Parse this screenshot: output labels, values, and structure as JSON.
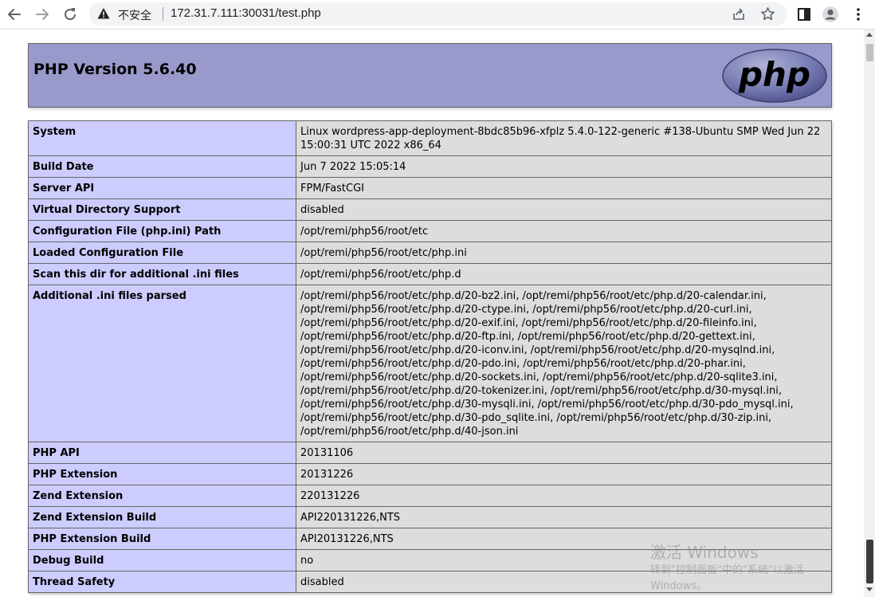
{
  "browser": {
    "security_label": "不安全",
    "url": "172.31.7.111:30031/test.php"
  },
  "page": {
    "title": "PHP Version 5.6.40",
    "logo_text": "php",
    "rows": [
      {
        "key": "System",
        "value": [
          "Linux wordpress-app-deployment-8bdc85b96-xfplz 5.4.0-122-generic #138-Ubuntu SMP Wed Jun 22",
          "15:00:31 UTC 2022 x86_64"
        ]
      },
      {
        "key": "Build Date",
        "value": [
          "Jun 7 2022 15:05:14"
        ]
      },
      {
        "key": "Server API",
        "value": [
          "FPM/FastCGI"
        ]
      },
      {
        "key": "Virtual Directory Support",
        "value": [
          "disabled"
        ]
      },
      {
        "key": "Configuration File (php.ini) Path",
        "value": [
          "/opt/remi/php56/root/etc"
        ]
      },
      {
        "key": "Loaded Configuration File",
        "value": [
          "/opt/remi/php56/root/etc/php.ini"
        ]
      },
      {
        "key": "Scan this dir for additional .ini files",
        "value": [
          "/opt/remi/php56/root/etc/php.d"
        ]
      },
      {
        "key": "Additional .ini files parsed",
        "value": [
          "/opt/remi/php56/root/etc/php.d/20-bz2.ini, /opt/remi/php56/root/etc/php.d/20-calendar.ini,",
          "/opt/remi/php56/root/etc/php.d/20-ctype.ini, /opt/remi/php56/root/etc/php.d/20-curl.ini,",
          "/opt/remi/php56/root/etc/php.d/20-exif.ini, /opt/remi/php56/root/etc/php.d/20-fileinfo.ini,",
          "/opt/remi/php56/root/etc/php.d/20-ftp.ini, /opt/remi/php56/root/etc/php.d/20-gettext.ini,",
          "/opt/remi/php56/root/etc/php.d/20-iconv.ini, /opt/remi/php56/root/etc/php.d/20-mysqlnd.ini,",
          "/opt/remi/php56/root/etc/php.d/20-pdo.ini, /opt/remi/php56/root/etc/php.d/20-phar.ini,",
          "/opt/remi/php56/root/etc/php.d/20-sockets.ini, /opt/remi/php56/root/etc/php.d/20-sqlite3.ini,",
          "/opt/remi/php56/root/etc/php.d/20-tokenizer.ini, /opt/remi/php56/root/etc/php.d/30-mysql.ini,",
          "/opt/remi/php56/root/etc/php.d/30-mysqli.ini, /opt/remi/php56/root/etc/php.d/30-pdo_mysql.ini,",
          "/opt/remi/php56/root/etc/php.d/30-pdo_sqlite.ini, /opt/remi/php56/root/etc/php.d/30-zip.ini,",
          "/opt/remi/php56/root/etc/php.d/40-json.ini"
        ]
      },
      {
        "key": "PHP API",
        "value": [
          "20131106"
        ]
      },
      {
        "key": "PHP Extension",
        "value": [
          "20131226"
        ]
      },
      {
        "key": "Zend Extension",
        "value": [
          "220131226"
        ]
      },
      {
        "key": "Zend Extension Build",
        "value": [
          "API220131226,NTS"
        ]
      },
      {
        "key": "PHP Extension Build",
        "value": [
          "API20131226,NTS"
        ]
      },
      {
        "key": "Debug Build",
        "value": [
          "no"
        ]
      },
      {
        "key": "Thread Safety",
        "value": [
          "disabled"
        ]
      }
    ]
  },
  "watermark": {
    "title": "激活 Windows",
    "subtitle_1": "转到\"控制面板\"中的\"系统\"以激活",
    "subtitle_2": "Windows。"
  },
  "colors": {
    "header_bg": "#9999cc",
    "key_cell_bg": "#ccccff",
    "value_cell_bg": "#dddddd",
    "border": "#666666"
  },
  "icons": [
    "back-arrow-icon",
    "forward-arrow-icon",
    "reload-icon",
    "warning-icon",
    "share-icon",
    "star-icon",
    "side-panel-icon",
    "profile-icon",
    "menu-dots-icon"
  ]
}
